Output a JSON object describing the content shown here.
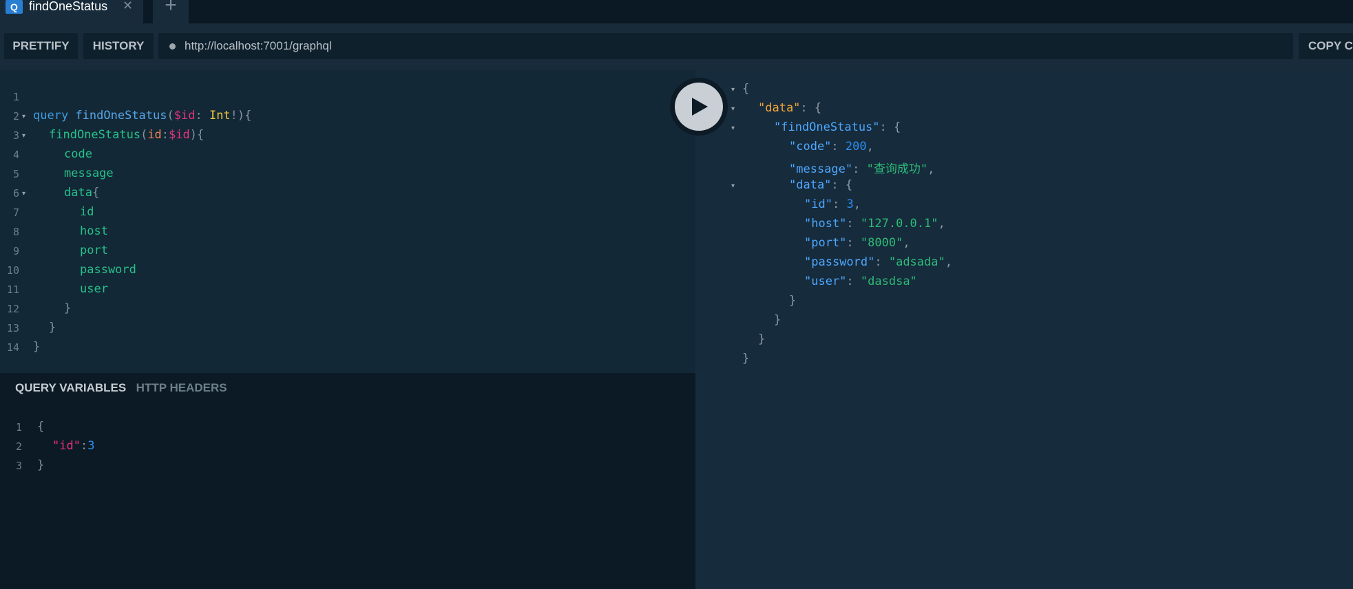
{
  "tab": {
    "badge": "Q",
    "title": "findOneStatus",
    "close_icon": "close-icon",
    "add_icon": "plus-icon"
  },
  "toolbar": {
    "prettify_label": "PRETTIFY",
    "history_label": "HISTORY",
    "url": "http://localhost:7001/graphql",
    "copy_label": "COPY C"
  },
  "query_editor": {
    "line_numbers": [
      "1",
      "2",
      "3",
      "4",
      "5",
      "6",
      "7",
      "8",
      "9",
      "10",
      "11",
      "12",
      "13",
      "14"
    ],
    "tokens": {
      "query_kw": "query",
      "op_name": "findOneStatus",
      "open_paren": "(",
      "var_id": "$id",
      "colon_sp": ": ",
      "type_int": "Int",
      "bang_close": "!){",
      "field_call": "findOneStatus",
      "paren_open2": "(",
      "arg_id": "id",
      "colon2": ":",
      "var_id2": "$id",
      "paren_close2": "){",
      "f_code": "code",
      "f_message": "message",
      "f_data": "data",
      "brace_open": "{",
      "f_id": "id",
      "f_host": "host",
      "f_port": "port",
      "f_password": "password",
      "f_user": "user",
      "brace_close": "}"
    }
  },
  "variables_panel": {
    "tab_query_variables": "QUERY VARIABLES",
    "tab_http_headers": "HTTP HEADERS",
    "line_numbers": [
      "1",
      "2",
      "3"
    ],
    "open": "{",
    "key": "\"id\"",
    "colon": ":",
    "value": "3",
    "close": "}"
  },
  "result": {
    "open": "{",
    "data_key": "\"data\"",
    "sep_obj": ": {",
    "find_key": "\"findOneStatus\"",
    "code_key": "\"code\"",
    "code_val": "200",
    "message_key": "\"message\"",
    "message_val": "\"查询成功\"",
    "data_key2": "\"data\"",
    "id_key": "\"id\"",
    "id_val": "3",
    "host_key": "\"host\"",
    "host_val": "\"127.0.0.1\"",
    "port_key": "\"port\"",
    "port_val": "\"8000\"",
    "password_key": "\"password\"",
    "password_val": "\"adsada\"",
    "user_key": "\"user\"",
    "user_val": "\"dasdsa\"",
    "colon_sp": ": ",
    "comma": ",",
    "close": "}"
  },
  "play_button": {
    "icon": "play-icon"
  }
}
